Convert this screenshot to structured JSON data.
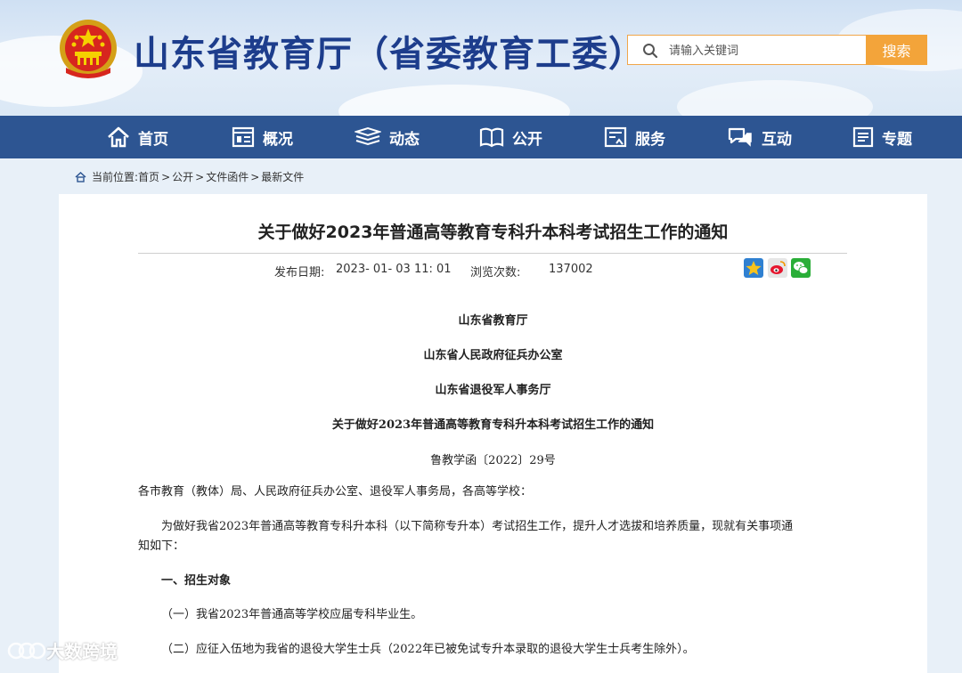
{
  "header": {
    "site_title": "山东省教育厅（省委教育工委）",
    "search_placeholder": "请输入关键词",
    "search_button": "搜索"
  },
  "nav": {
    "items": [
      {
        "label": "首页",
        "icon": "home-icon"
      },
      {
        "label": "概况",
        "icon": "overview-icon"
      },
      {
        "label": "动态",
        "icon": "news-icon"
      },
      {
        "label": "公开",
        "icon": "book-icon"
      },
      {
        "label": "服务",
        "icon": "service-icon"
      },
      {
        "label": "互动",
        "icon": "chat-icon"
      },
      {
        "label": "专题",
        "icon": "topic-icon"
      }
    ]
  },
  "breadcrumb": {
    "prefix": "当前位置:",
    "items": [
      "首页",
      "公开",
      "文件函件",
      "最新文件"
    ],
    "separator": ">"
  },
  "article": {
    "title": "关于做好2023年普通高等教育专科升本科考试招生工作的通知",
    "date_label": "发布日期:",
    "date_value": "2023- 01- 03 11: 01",
    "views_label": "浏览次数:",
    "views_value": "137002",
    "issuers": [
      "山东省教育厅",
      "山东省人民政府征兵办公室",
      "山东省退役军人事务厅"
    ],
    "doc_title": "关于做好2023年普通高等教育专科升本科考试招生工作的通知",
    "doc_number": "鲁教学函〔2022〕29号",
    "addressee": "各市教育（教体）局、人民政府征兵办公室、退役军人事务局，各高等学校：",
    "intro_line1": "为做好我省2023年普通高等教育专科升本科（以下简称专升本）考试招生工作，提升人才选拔和培养质量，现就有关事项通",
    "intro_line2": "知如下：",
    "section1": "一、招生对象",
    "item1": "（一）我省2023年普通高等学校应届专科毕业生。",
    "item2": "（二）应征入伍地为我省的退役大学生士兵（2022年已被免试专升本录取的退役大学生士兵考生除外）。"
  },
  "share": {
    "icons": [
      "qzone-icon",
      "weibo-icon",
      "wechat-icon"
    ]
  },
  "watermark": "大数跨境",
  "colors": {
    "nav_bg": "#2d5592",
    "title_blue": "#1d3d8c",
    "search_orange": "#f3a43a"
  }
}
